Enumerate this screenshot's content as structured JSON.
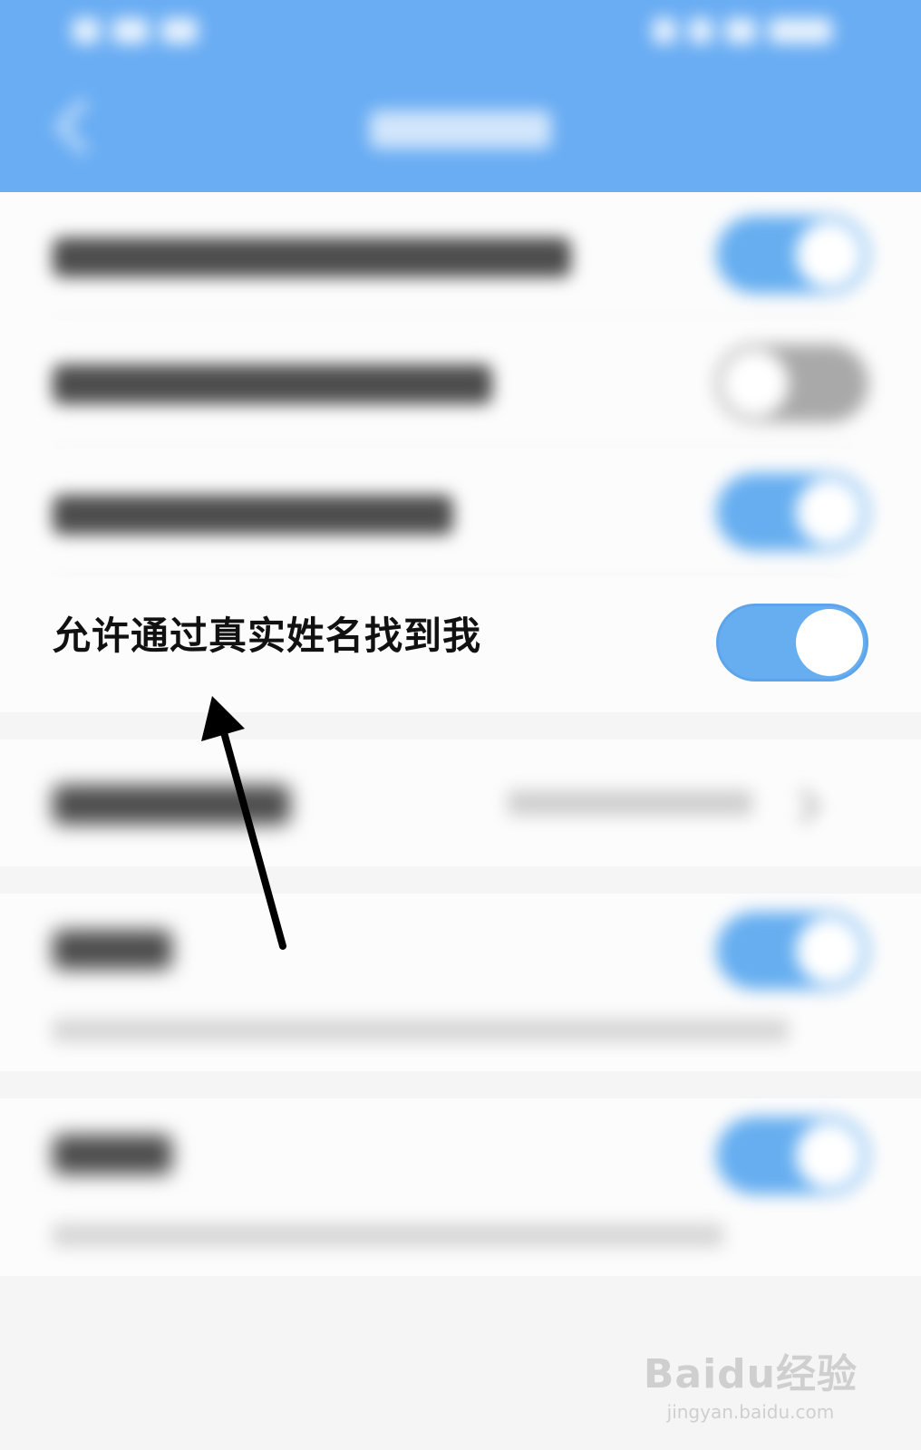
{
  "rows": {
    "real_name_label": "允许通过真实姓名找到我"
  },
  "toggles": {
    "followers_view_homepage": "on",
    "strangers_view_homepage": "off",
    "find_by_phone": "on",
    "find_by_real_name": "on",
    "option_six": "on",
    "option_seven": "on"
  },
  "colors": {
    "header_bg": "#6aadf3",
    "toggle_on": "#66aef0",
    "toggle_off": "#a9a9a9",
    "arrow": "#000000"
  },
  "icons": [
    "back-chevron-icon",
    "chevron-right-icon",
    "annotation-arrow-icon"
  ],
  "watermark": {
    "brand": "Baidu经验",
    "url": "jingyan.baidu.com"
  }
}
